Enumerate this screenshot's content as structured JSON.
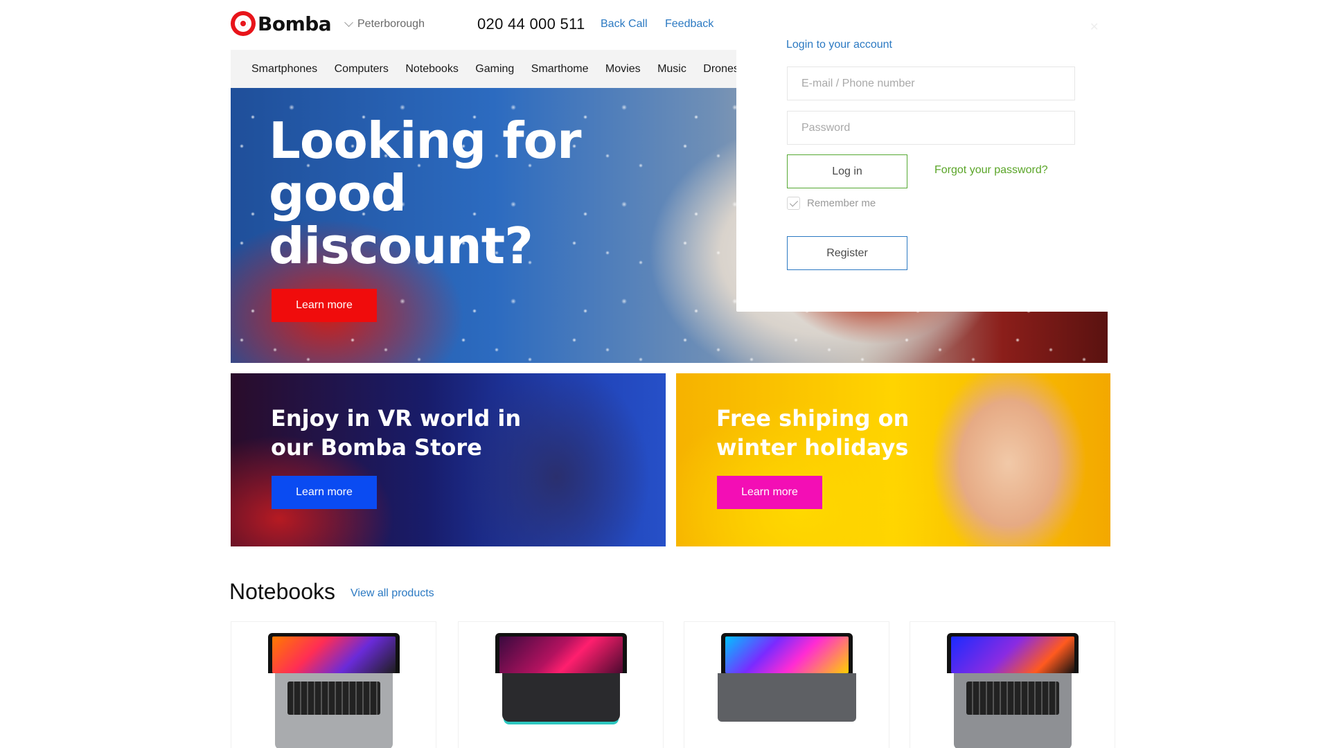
{
  "brand": {
    "name": "Bomba",
    "accent": "#e8141a"
  },
  "header": {
    "city": "Peterborough",
    "phone": "020 44 000 511",
    "back_call": "Back Call",
    "feedback": "Feedback"
  },
  "nav": {
    "items": [
      "Smartphones",
      "Computers",
      "Notebooks",
      "Gaming",
      "Smarthome",
      "Movies",
      "Music",
      "Drones"
    ]
  },
  "hero": {
    "title": "Looking for good discount?",
    "button": "Learn more",
    "button_color": "#f00c0c"
  },
  "promos": [
    {
      "title": "Enjoy in VR world in our Bomba Store",
      "button": "Learn more",
      "button_color": "#0a4bf2"
    },
    {
      "title": "Free shiping on winter holidays",
      "button": "Learn more",
      "button_color": "#f30eb5"
    }
  ],
  "notebooks": {
    "title": "Notebooks",
    "view_all": "View all products"
  },
  "login": {
    "heading": "Login to your account",
    "email_placeholder": "E-mail / Phone number",
    "password_placeholder": "Password",
    "login_button": "Log in",
    "forgot": "Forgot your password?",
    "remember": "Remember me",
    "register_button": "Register"
  },
  "colors": {
    "link": "#2b79c2",
    "forgot_link": "#5aa528",
    "login_border": "#55a832"
  }
}
